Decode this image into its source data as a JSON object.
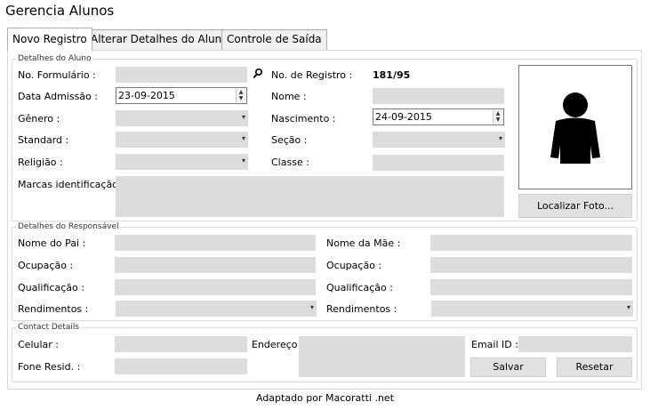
{
  "app": {
    "title": "Gerencia Alunos"
  },
  "tabs": [
    {
      "label": "Novo Registro"
    },
    {
      "label": "Alterar Detalhes do Aluno"
    },
    {
      "label": "Controle de Saída"
    }
  ],
  "aluno": {
    "legend": "Detalhes do Aluno",
    "no_formulario_label": "No. Formulário :",
    "no_registro_label": "No. de Registro :",
    "no_registro_value": "181/95",
    "data_admissao_label": "Data Admissão :",
    "data_admissao_value": "23-09-2015",
    "nome_label": "Nome :",
    "genero_label": "Gênero :",
    "nascimento_label": "Nascimento :",
    "nascimento_value": "24-09-2015",
    "standard_label": "Standard :",
    "secao_label": "Seção :",
    "religiao_label": "Religião :",
    "classe_label": "Classe :",
    "marcas_label": "Marcas identificação :",
    "localizar_foto": "Localizar Foto..."
  },
  "responsavel": {
    "legend": "Detalhes do Responsável",
    "nome_pai_label": "Nome do Pai :",
    "nome_mae_label": "Nome da Mãe :",
    "ocupacao_label": "Ocupação :",
    "ocupacao2_label": "Ocupação :",
    "qualificacao_label": "Qualificação :",
    "qualificacao2_label": "Qualificação :",
    "rendimentos_label": "Rendimentos :",
    "rendimentos2_label": "Rendimentos :"
  },
  "contact": {
    "legend": "Contact Details",
    "celular_label": "Celular :",
    "endereco_label": "Endereço :",
    "email_label": "Email ID :",
    "fone_label": "Fone Resid. :",
    "salvar": "Salvar",
    "resetar": "Resetar"
  },
  "footer": {
    "text": "Adaptado por Macoratti .net"
  }
}
